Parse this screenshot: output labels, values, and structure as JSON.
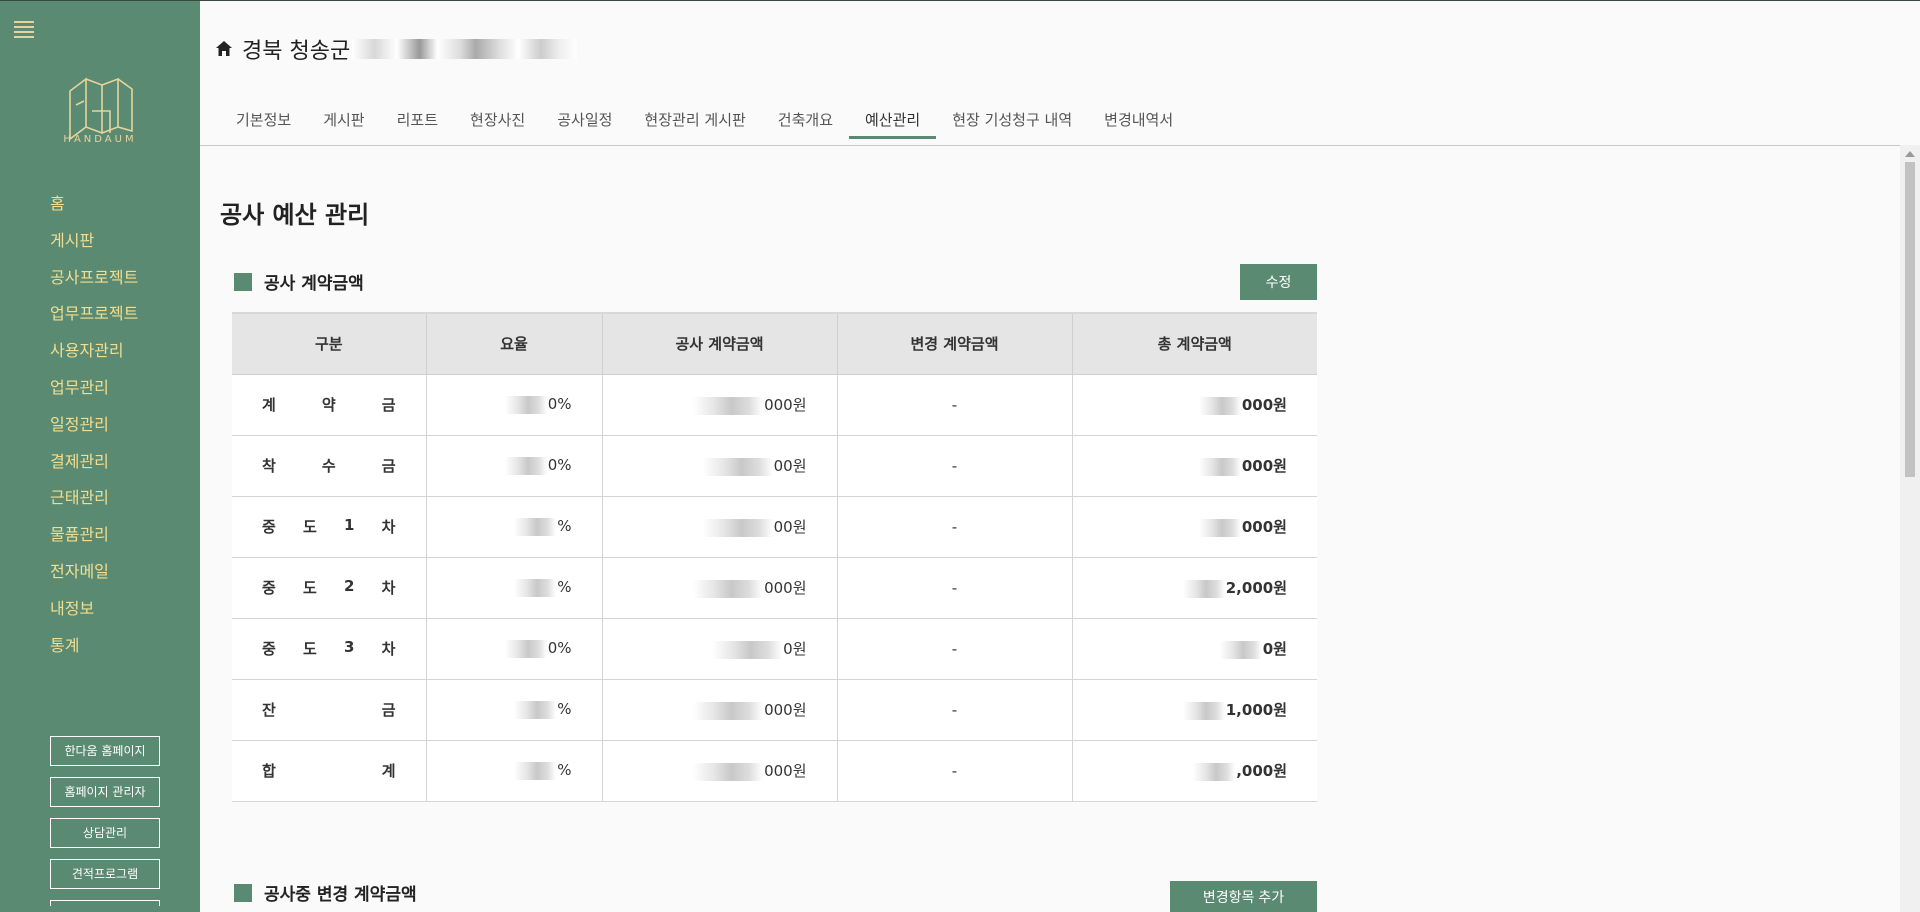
{
  "sidebar": {
    "logo_text": "HANDAUM",
    "nav": [
      "홈",
      "게시판",
      "공사프로젝트",
      "업무프로젝트",
      "사용자관리",
      "업무관리",
      "일정관리",
      "결제관리",
      "근태관리",
      "물품관리",
      "전자메일",
      "내정보",
      "통계"
    ],
    "buttons": [
      "한다움 홈페이지",
      "홈페이지 관리자",
      "상담관리",
      "견적프로그램"
    ],
    "bg_color": "#5b8a72",
    "text_color": "#f1de8f"
  },
  "header": {
    "breadcrumb": "경북 청송군",
    "tabs": [
      "기본정보",
      "게시판",
      "리포트",
      "현장사진",
      "공사일정",
      "현장관리 게시판",
      "건축개요",
      "예산관리",
      "현장 기성청구 내역",
      "변경내역서"
    ],
    "active_tab": "예산관리"
  },
  "main": {
    "page_title": "공사 예산 관리",
    "section1": {
      "title": "공사 계약금액",
      "edit_button": "수정",
      "columns": [
        "구분",
        "요율",
        "공사 계약금액",
        "변경 계약금액",
        "총 계약금액"
      ],
      "rows": [
        {
          "chars": [
            "계",
            "약",
            "금"
          ],
          "rate": "0%",
          "contract": "000원",
          "change": "-",
          "total": "000원"
        },
        {
          "chars": [
            "착",
            "수",
            "금"
          ],
          "rate": "0%",
          "contract": "00원",
          "change": "-",
          "total": "000원"
        },
        {
          "chars": [
            "중",
            "도",
            "1",
            "차"
          ],
          "rate": "%",
          "contract": "00원",
          "change": "-",
          "total": "000원"
        },
        {
          "chars": [
            "중",
            "도",
            "2",
            "차"
          ],
          "rate": "%",
          "contract": "000원",
          "change": "-",
          "total": "2,000원"
        },
        {
          "chars": [
            "중",
            "도",
            "3",
            "차"
          ],
          "rate": "0%",
          "contract": "0원",
          "change": "-",
          "total": "0원"
        },
        {
          "chars": [
            "잔",
            "금"
          ],
          "rate": "%",
          "contract": "000원",
          "change": "-",
          "total": "1,000원"
        },
        {
          "chars": [
            "합",
            "계"
          ],
          "rate": "%",
          "contract": "000원",
          "change": "-",
          "total": ",000원"
        }
      ]
    },
    "section2": {
      "title": "공사중 변경 계약금액",
      "add_button": "변경항목 추가"
    }
  }
}
